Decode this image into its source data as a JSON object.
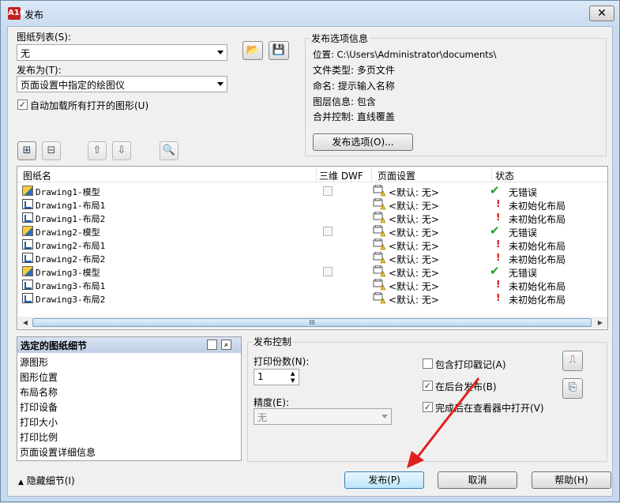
{
  "window": {
    "title": "发布",
    "app_icon_text": "A16",
    "close_glyph": "✕"
  },
  "left": {
    "sheet_list_label": "图纸列表(S):",
    "sheet_list_value": "无",
    "publish_to_label": "发布为(T):",
    "publish_to_value": "页面设置中指定的绘图仪",
    "auto_load_label": "自动加载所有打开的图形(U)",
    "auto_load_checked": true
  },
  "options_info": {
    "title": "发布选项信息",
    "location": "位置: C:\\Users\\Administrator\\documents\\",
    "file_type": "文件类型: 多页文件",
    "naming": "命名: 提示输入名称",
    "layer_info": "图层信息: 包含",
    "merge_control": "合并控制: 直线覆盖",
    "options_button": "发布选项(O)..."
  },
  "sheet_table": {
    "columns": [
      "图纸名",
      "三维 DWF",
      "页面设置",
      "状态"
    ],
    "rows": [
      {
        "name": "Drawing1-模型",
        "type": "model",
        "dwf3d": true,
        "page_setup": "<默认: 无>",
        "status": "无错误",
        "ok": true
      },
      {
        "name": "Drawing1-布局1",
        "type": "layout",
        "dwf3d": false,
        "page_setup": "<默认: 无>",
        "status": "未初始化布局",
        "ok": false
      },
      {
        "name": "Drawing1-布局2",
        "type": "layout",
        "dwf3d": false,
        "page_setup": "<默认: 无>",
        "status": "未初始化布局",
        "ok": false
      },
      {
        "name": "Drawing2-模型",
        "type": "model",
        "dwf3d": true,
        "page_setup": "<默认: 无>",
        "status": "无错误",
        "ok": true
      },
      {
        "name": "Drawing2-布局1",
        "type": "layout",
        "dwf3d": false,
        "page_setup": "<默认: 无>",
        "status": "未初始化布局",
        "ok": false
      },
      {
        "name": "Drawing2-布局2",
        "type": "layout",
        "dwf3d": false,
        "page_setup": "<默认: 无>",
        "status": "未初始化布局",
        "ok": false
      },
      {
        "name": "Drawing3-模型",
        "type": "model",
        "dwf3d": true,
        "page_setup": "<默认: 无>",
        "status": "无错误",
        "ok": true
      },
      {
        "name": "Drawing3-布局1",
        "type": "layout",
        "dwf3d": false,
        "page_setup": "<默认: 无>",
        "status": "未初始化布局",
        "ok": false
      },
      {
        "name": "Drawing3-布局2",
        "type": "layout",
        "dwf3d": false,
        "page_setup": "<默认: 无>",
        "status": "未初始化布局",
        "ok": false
      }
    ],
    "scroll_grip": "III"
  },
  "details": {
    "title": "选定的图纸细节",
    "items": [
      "源图形",
      "图形位置",
      "布局名称",
      "打印设备",
      "打印大小",
      "打印比例",
      "页面设置详细信息"
    ]
  },
  "publish_control": {
    "title": "发布控制",
    "copies_label": "打印份数(N):",
    "copies_value": "1",
    "precision_label": "精度(E):",
    "precision_value": "无",
    "stamp_label": "包含打印戳记(A)",
    "stamp_checked": false,
    "background_label": "在后台发布(B)",
    "background_checked": true,
    "open_viewer_label": "完成后在查看器中打开(V)",
    "open_viewer_checked": true
  },
  "footer": {
    "hide_details": "隐藏细节(I)",
    "publish_button": "发布(P)",
    "cancel_button": "取消",
    "help_button": "帮助(H)"
  },
  "colors": {
    "ok": "#2c9a2c",
    "error": "#d01010",
    "annotation_arrow": "#e02020"
  }
}
